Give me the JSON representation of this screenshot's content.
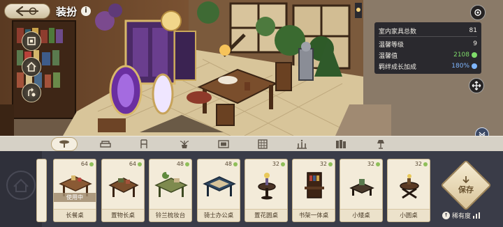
{
  "header": {
    "title": "装扮",
    "back_icon": "back-arrow-icon",
    "info_icon": "info-icon",
    "info_glyph": "i"
  },
  "side_tools": [
    {
      "icon": "layout-frame-icon"
    },
    {
      "icon": "home-icon"
    },
    {
      "icon": "rotate-hand-icon"
    }
  ],
  "top_right": {
    "screenshot_icon": "camera-icon",
    "move_icon": "move-arrows-icon"
  },
  "stats": {
    "total_label": "室内家具总数",
    "total_value": "81",
    "level_label": "温馨等级",
    "level_value": "9",
    "cozy_label": "温馨值",
    "cozy_value": "2108",
    "bond_label": "羁绊成长加成",
    "bond_value": "180%",
    "cozy_color": "#7fdc6a",
    "bond_color": "#7fb6ff"
  },
  "categories": [
    {
      "icon": "table-icon",
      "active": true
    },
    {
      "icon": "sofa-icon",
      "active": false
    },
    {
      "icon": "chair-icon",
      "active": false
    },
    {
      "icon": "plant-icon",
      "active": false
    },
    {
      "icon": "frame-icon",
      "active": false
    },
    {
      "icon": "rug-icon",
      "active": false
    },
    {
      "icon": "candle-icon",
      "active": false
    },
    {
      "icon": "books-icon",
      "active": false
    },
    {
      "icon": "lamp-icon",
      "active": false
    }
  ],
  "items": [
    {
      "name": "长餐桌",
      "count": "64",
      "in_use": "使用中"
    },
    {
      "name": "置物长桌",
      "count": "64"
    },
    {
      "name": "铃兰梳妆台",
      "count": "48"
    },
    {
      "name": "骑士办公桌",
      "count": "48"
    },
    {
      "name": "置花圆桌",
      "count": "32"
    },
    {
      "name": "书架一体桌",
      "count": "32"
    },
    {
      "name": "小矮桌",
      "count": "32"
    },
    {
      "name": "小圆桌",
      "count": "32"
    }
  ],
  "save": {
    "label": "保存"
  },
  "rarity": {
    "label": "稀有度"
  },
  "colors": {
    "accent": "#d9c49a",
    "panel": "#3a3c48",
    "card": "#f3ebd9"
  }
}
